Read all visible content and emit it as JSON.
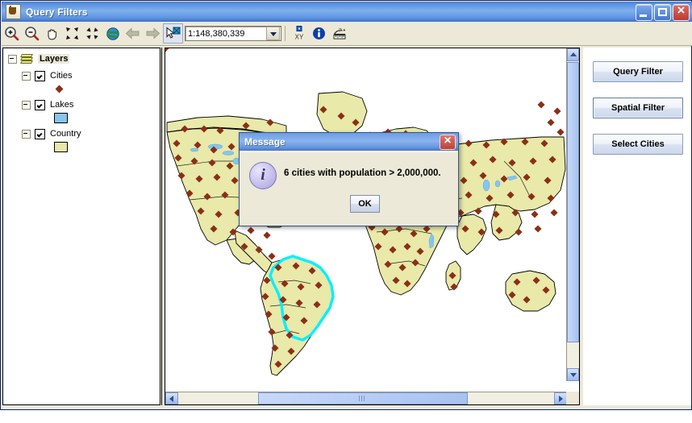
{
  "window": {
    "title": "Query Filters",
    "icon": "java-cup-icon",
    "controls": [
      {
        "name": "minimize-button",
        "glyph": "minimize-icon"
      },
      {
        "name": "maximize-button",
        "glyph": "maximize-icon"
      },
      {
        "name": "close-button",
        "glyph": "close-icon"
      }
    ]
  },
  "toolbar": {
    "tools": [
      {
        "name": "zoom-in-tool",
        "icon": "zoom-in-icon"
      },
      {
        "name": "zoom-out-tool",
        "icon": "zoom-out-icon"
      },
      {
        "name": "pan-tool",
        "icon": "hand-icon"
      },
      {
        "name": "zoom-to-selection-tool",
        "icon": "arrows-in-icon"
      },
      {
        "name": "full-extent-tool",
        "icon": "arrows-out-icon"
      },
      {
        "name": "globe-tool",
        "icon": "globe-icon"
      },
      {
        "name": "back-tool",
        "icon": "arrow-left-icon"
      },
      {
        "name": "forward-tool",
        "icon": "arrow-right-icon"
      },
      {
        "name": "select-tool",
        "icon": "select-pointer-icon"
      }
    ],
    "scale": {
      "value": "1:148,380,339",
      "placeholder": "1:148,380,339"
    },
    "right_tools": [
      {
        "name": "xy-coordinate-tool",
        "icon": "xy-icon",
        "label": "XY"
      },
      {
        "name": "identify-tool",
        "icon": "info-circle-icon"
      },
      {
        "name": "measure-tool",
        "icon": "ruler-question-icon"
      }
    ]
  },
  "layer_tree": {
    "root": {
      "label": "Layers",
      "icon": "layers-icon",
      "expanded": true
    },
    "layers": [
      {
        "label": "Cities",
        "checked": true,
        "expanded": true,
        "symbol": "diamond",
        "color": "#8b2f16"
      },
      {
        "label": "Lakes",
        "checked": true,
        "expanded": true,
        "symbol": "box",
        "color": "#86c5ee"
      },
      {
        "label": "Country",
        "checked": true,
        "expanded": true,
        "symbol": "box",
        "color": "#e8e8a8"
      }
    ]
  },
  "map": {
    "land_color": "#e9e9a9",
    "ocean_color": "#ffffff",
    "border_color": "#000000",
    "lake_color": "#86c5ee",
    "city_color": "#8b2f16",
    "selection_color": "#00f0ff",
    "selected_feature": "Brazil",
    "scrollbars": {
      "vertical": {
        "up": "scroll-up-icon",
        "down": "scroll-down-icon",
        "thumb_top_pct": 3,
        "thumb_height_pct": 84
      },
      "horizontal": {
        "left": "scroll-left-icon",
        "right": "scroll-right-icon",
        "thumb_left_pct": 23,
        "thumb_width_pct": 52
      }
    }
  },
  "side_panel": {
    "buttons": [
      {
        "label": "Query Filter",
        "name": "query-filter-button"
      },
      {
        "label": "Spatial Filter",
        "name": "spatial-filter-button"
      },
      {
        "label": "Select Cities",
        "name": "select-cities-button"
      }
    ]
  },
  "dialog": {
    "title": "Message",
    "icon": "info-icon",
    "message": "6 cities with population > 2,000,000.",
    "ok_label": "OK",
    "close_icon": "close-icon"
  }
}
